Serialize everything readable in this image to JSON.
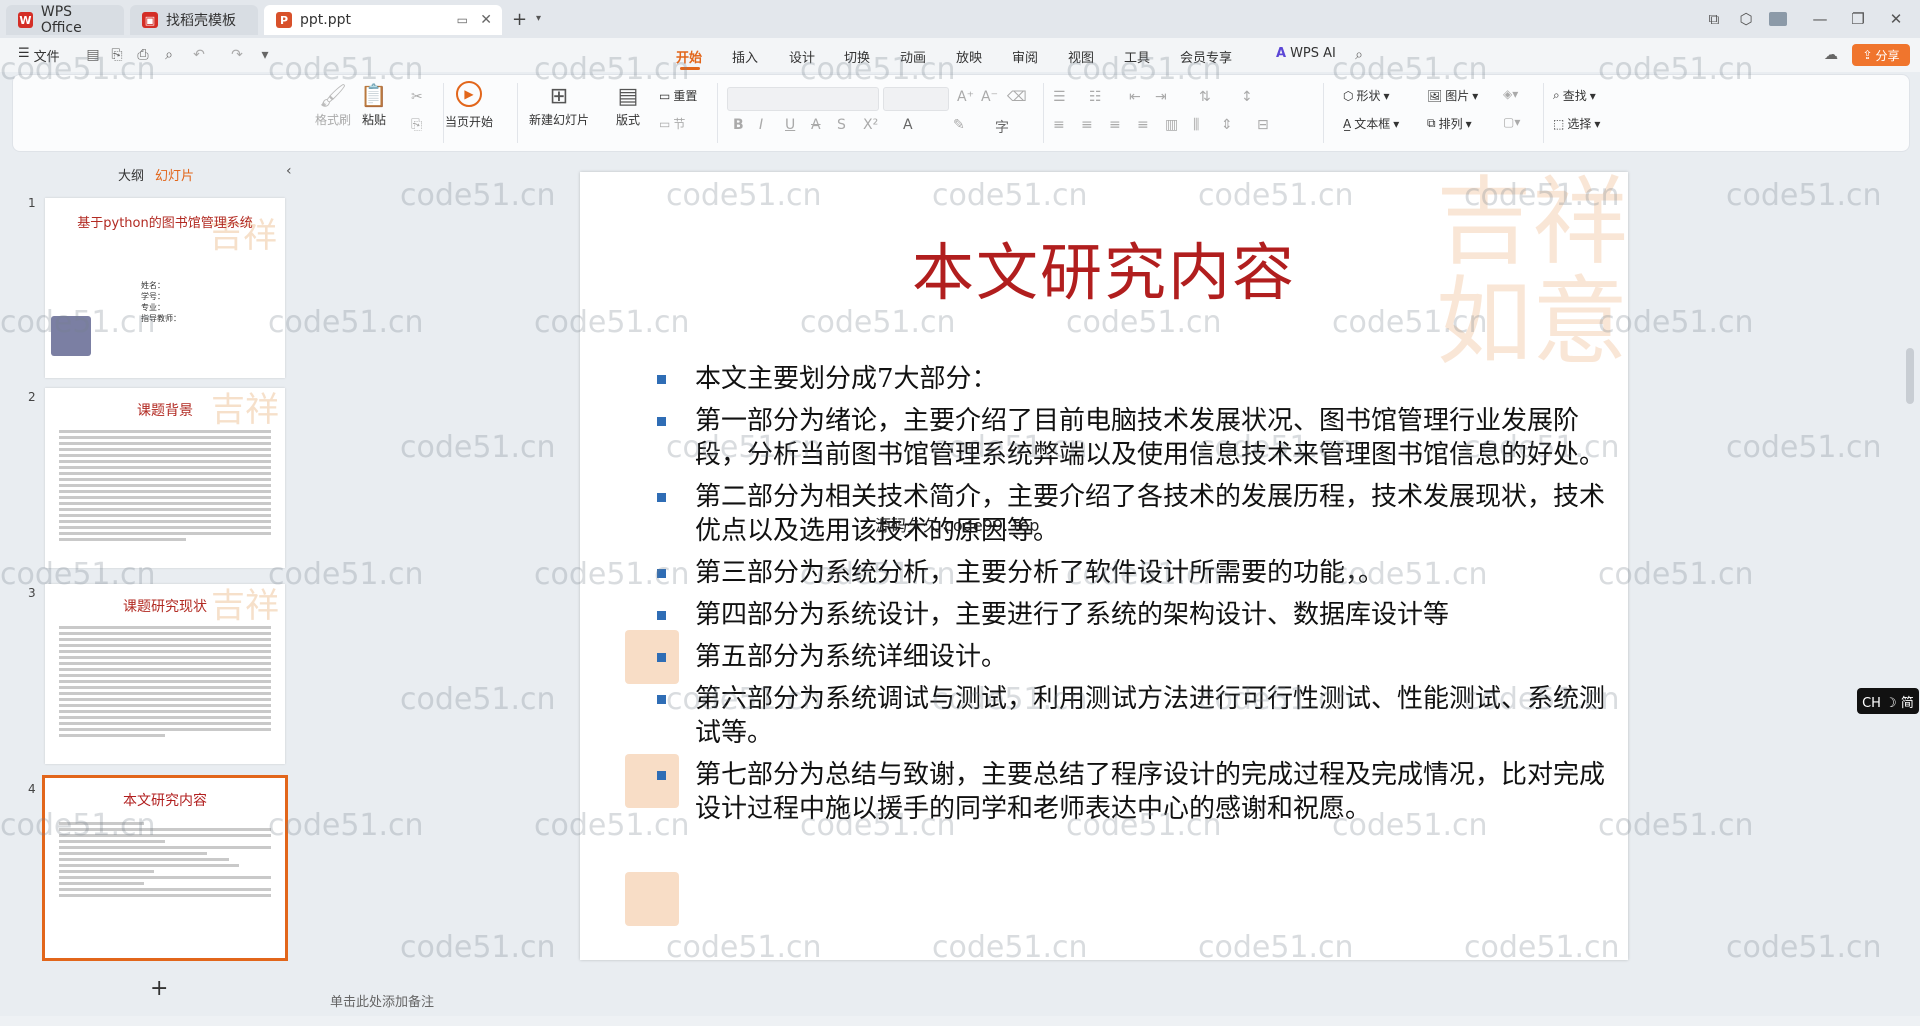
{
  "titlebar": {
    "tabs": [
      {
        "label": "WPS Office",
        "logo": "W",
        "color": "#d42e26"
      },
      {
        "label": "找稻壳模板",
        "logo": "▣",
        "color": "#d42e26"
      },
      {
        "label": "ppt.ppt",
        "logo": "P",
        "color": "#d8512b"
      }
    ]
  },
  "menu": {
    "file_label": "文件",
    "tabs": [
      "开始",
      "插入",
      "设计",
      "切换",
      "动画",
      "放映",
      "审阅",
      "视图",
      "工具",
      "会员专享"
    ],
    "active_tab": "开始",
    "wps_ai": "WPS AI",
    "share": "分享"
  },
  "ribbon": {
    "format_painter": "格式刷",
    "paste": "粘贴",
    "from_current": "当页开始",
    "new_slide": "新建幻灯片",
    "layout": "版式",
    "reset": "重置",
    "section": "节",
    "shape": "形状",
    "picture": "图片",
    "textbox": "文本框",
    "arrange": "排列",
    "find": "查找",
    "select": "选择"
  },
  "left_panel": {
    "outline_tab": "大纲",
    "slides_tab": "幻灯片",
    "slides": [
      {
        "num": "1",
        "title": "基于python的图书馆管理系统",
        "lines": [
          "姓名：",
          "学号：",
          "专业：",
          "指导教师："
        ]
      },
      {
        "num": "2",
        "title": "课题背景"
      },
      {
        "num": "3",
        "title": "课题研究现状"
      },
      {
        "num": "4",
        "title": "本文研究内容"
      }
    ],
    "add_label": "+"
  },
  "slide": {
    "title": "本文研究内容",
    "bullets": [
      "本文主要划分成7大部分：",
      "第一部分为绪论，主要介绍了目前电脑技术发展状况、图书馆管理行业发展阶段，分析当前图书馆管理系统弊端以及使用信息技术来管理图书馆信息的好处。",
      "第二部分为相关技术简介，主要介绍了各技术的发展历程，技术发展现状，技术优点以及选用该技术的原因等。",
      "第三部分为系统分析，主要分析了软件设计所需要的功能，。",
      "第四部分为系统设计，主要进行了系统的架构设计、数据库设计等",
      "第五部分为系统详细设计。",
      "第六部分为系统调试与测试，利用测试方法进行可行性测试、性能测试、系统测试等。",
      "第七部分为总结与致谢，主要总结了程序设计的完成过程及完成情况，比对完成设计过程中施以援手的同学和老师表达中心的感谢和祝愿。"
    ],
    "overlay": "源码久久 code99. top",
    "seal_text": "吉祥如意"
  },
  "watermark": "code51.cn",
  "notes_placeholder": "单击此处添加备注",
  "ime": "CH ☽ 简"
}
